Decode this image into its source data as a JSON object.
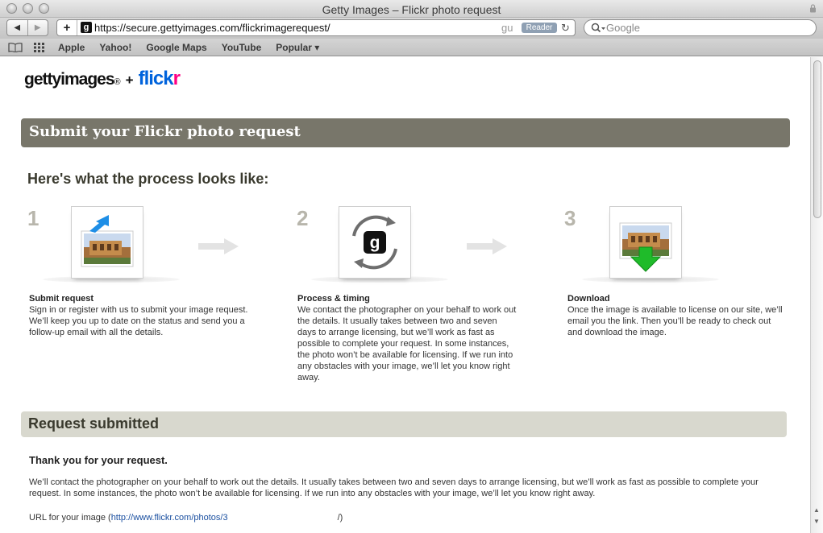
{
  "window": {
    "title": "Getty Images – Flickr photo request"
  },
  "toolbar": {
    "url": "https://secure.gettyimages.com/flickrimagerequest/",
    "url_tail": "gu",
    "reader_label": "Reader",
    "search_placeholder": "Google",
    "add_label": "+"
  },
  "bookmarks": [
    "Apple",
    "Yahoo!",
    "Google Maps",
    "YouTube",
    "Popular ▾"
  ],
  "logo": {
    "getty": "gettyimages",
    "reg": "®",
    "plus": "+",
    "flickr_a": "flick",
    "flickr_b": "r"
  },
  "banner": {
    "title": "Submit your Flickr photo request"
  },
  "process": {
    "heading": "Here's what the process looks like:",
    "steps": [
      {
        "num": "1",
        "title": "Submit request",
        "desc": "Sign in or register with us to submit your image request. We’ll keep you up to date on the status and send you a follow-up email with all the details."
      },
      {
        "num": "2",
        "title": "Process & timing",
        "desc": "We contact the photographer on your behalf to work out the details. It usually takes between two and seven days to arrange licensing, but we’ll work as fast as possible to complete your request. In some instances, the photo won’t be available for licensing. If we run into any obstacles with your image, we’ll let you know right away."
      },
      {
        "num": "3",
        "title": "Download",
        "desc": "Once the image is available to license on our site, we’ll email you the link. Then you’ll be ready to check out and download the image."
      }
    ]
  },
  "submitted": {
    "title": "Request submitted",
    "thanks": "Thank you for your request.",
    "detail": "We’ll contact the photographer on your behalf to work out the details. It usually takes between two and seven days to arrange licensing, but we’ll work as fast as possible to complete your request. In some instances, the photo won’t be available for licensing. If we run into any obstacles with your image, we’ll let you know right away.",
    "url_label": "URL for your image (",
    "url_link": "http://www.flickr.com/photos/3",
    "url_end": "/)"
  },
  "colors": {
    "banner": "#78766a",
    "panel": "#d8d8ce",
    "flickr_blue": "#0063dc",
    "flickr_pink": "#ff0084"
  }
}
